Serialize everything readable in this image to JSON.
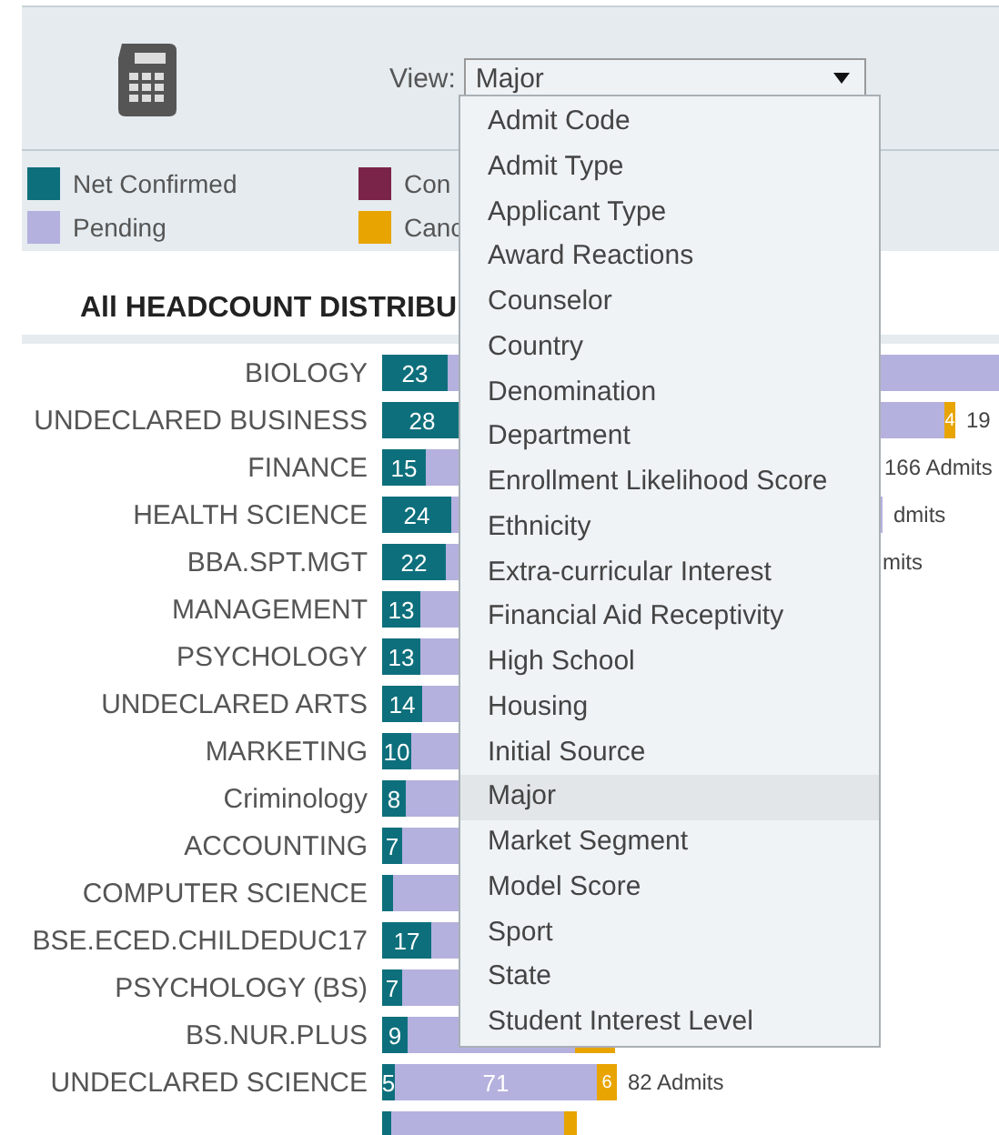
{
  "header": {
    "view_label": "View:",
    "view_value": "Major"
  },
  "dropdown": {
    "options": [
      {
        "label": "Admit Code",
        "selected": false
      },
      {
        "label": "Admit Type",
        "selected": false
      },
      {
        "label": "Applicant Type",
        "selected": false
      },
      {
        "label": "Award Reactions",
        "selected": false
      },
      {
        "label": "Counselor",
        "selected": false
      },
      {
        "label": "Country",
        "selected": false
      },
      {
        "label": "Denomination",
        "selected": false
      },
      {
        "label": "Department",
        "selected": false
      },
      {
        "label": "Enrollment Likelihood Score",
        "selected": false
      },
      {
        "label": "Ethnicity",
        "selected": false
      },
      {
        "label": "Extra-curricular Interest",
        "selected": false
      },
      {
        "label": "Financial Aid Receptivity",
        "selected": false
      },
      {
        "label": "High School",
        "selected": false
      },
      {
        "label": "Housing",
        "selected": false
      },
      {
        "label": "Initial Source",
        "selected": false
      },
      {
        "label": "Major",
        "selected": true
      },
      {
        "label": "Market Segment",
        "selected": false
      },
      {
        "label": "Model Score",
        "selected": false
      },
      {
        "label": "Sport",
        "selected": false
      },
      {
        "label": "State",
        "selected": false
      },
      {
        "label": "Student Interest Level",
        "selected": false
      }
    ]
  },
  "legend": [
    {
      "label": "Net Confirmed",
      "color": "#0e6f7c"
    },
    {
      "label": "Con",
      "color": "#7b2449"
    },
    {
      "label": "Pending",
      "color": "#b4b1de"
    },
    {
      "label": "Canc",
      "color": "#e8a400"
    }
  ],
  "chart": {
    "title": "All HEADCOUNT DISTRIBU",
    "rows": [
      {
        "label": "BIOLOGY",
        "segments": [
          {
            "kind": "net",
            "text": "23"
          },
          {
            "kind": "pending"
          }
        ]
      },
      {
        "label": "UNDECLARED BUSINESS",
        "segments": [
          {
            "kind": "net",
            "text": "28"
          },
          {
            "kind": "pending"
          },
          {
            "kind": "cancel",
            "text": "4"
          }
        ],
        "total": "19"
      },
      {
        "label": "FINANCE",
        "segments": [
          {
            "kind": "net",
            "text": "15"
          },
          {
            "kind": "pending"
          }
        ],
        "total": "166 Admits"
      },
      {
        "label": "HEALTH SCIENCE",
        "segments": [
          {
            "kind": "net",
            "text": "24"
          },
          {
            "kind": "pending"
          }
        ],
        "total": "dmits"
      },
      {
        "label": "BBA.SPT.MGT",
        "segments": [
          {
            "kind": "net",
            "text": "22"
          },
          {
            "kind": "pending"
          }
        ],
        "total": "mits"
      },
      {
        "label": "MANAGEMENT",
        "segments": [
          {
            "kind": "net",
            "text": "13"
          },
          {
            "kind": "pending"
          }
        ]
      },
      {
        "label": "PSYCHOLOGY",
        "segments": [
          {
            "kind": "net",
            "text": "13"
          },
          {
            "kind": "pending"
          }
        ]
      },
      {
        "label": "UNDECLARED ARTS",
        "segments": [
          {
            "kind": "net",
            "text": "14"
          },
          {
            "kind": "pending"
          }
        ]
      },
      {
        "label": "MARKETING",
        "segments": [
          {
            "kind": "net",
            "text": "10"
          },
          {
            "kind": "pending"
          }
        ]
      },
      {
        "label": "Criminology",
        "segments": [
          {
            "kind": "net",
            "text": "8"
          },
          {
            "kind": "pending"
          }
        ]
      },
      {
        "label": "ACCOUNTING",
        "segments": [
          {
            "kind": "net",
            "text": "7"
          },
          {
            "kind": "pending"
          }
        ]
      },
      {
        "label": "COMPUTER SCIENCE",
        "segments": [
          {
            "kind": "net"
          },
          {
            "kind": "pending"
          }
        ]
      },
      {
        "label": "BSE.ECED.CHILDEDUC17",
        "segments": [
          {
            "kind": "net",
            "text": "17"
          },
          {
            "kind": "pending"
          }
        ]
      },
      {
        "label": "PSYCHOLOGY (BS)",
        "segments": [
          {
            "kind": "net",
            "text": "7"
          },
          {
            "kind": "pending"
          }
        ]
      },
      {
        "label": "BS.NUR.PLUS",
        "segments": [
          {
            "kind": "net",
            "text": "9"
          },
          {
            "kind": "pending"
          },
          {
            "kind": "cancel"
          }
        ]
      },
      {
        "label": "UNDECLARED SCIENCE",
        "segments": [
          {
            "kind": "net",
            "text": "5"
          },
          {
            "kind": "pending",
            "text": "71"
          },
          {
            "kind": "cancel",
            "text": "6"
          }
        ],
        "total": "82 Admits"
      },
      {
        "segments": [
          {
            "kind": "net"
          },
          {
            "kind": "pending"
          },
          {
            "kind": "cancel"
          }
        ]
      }
    ]
  }
}
